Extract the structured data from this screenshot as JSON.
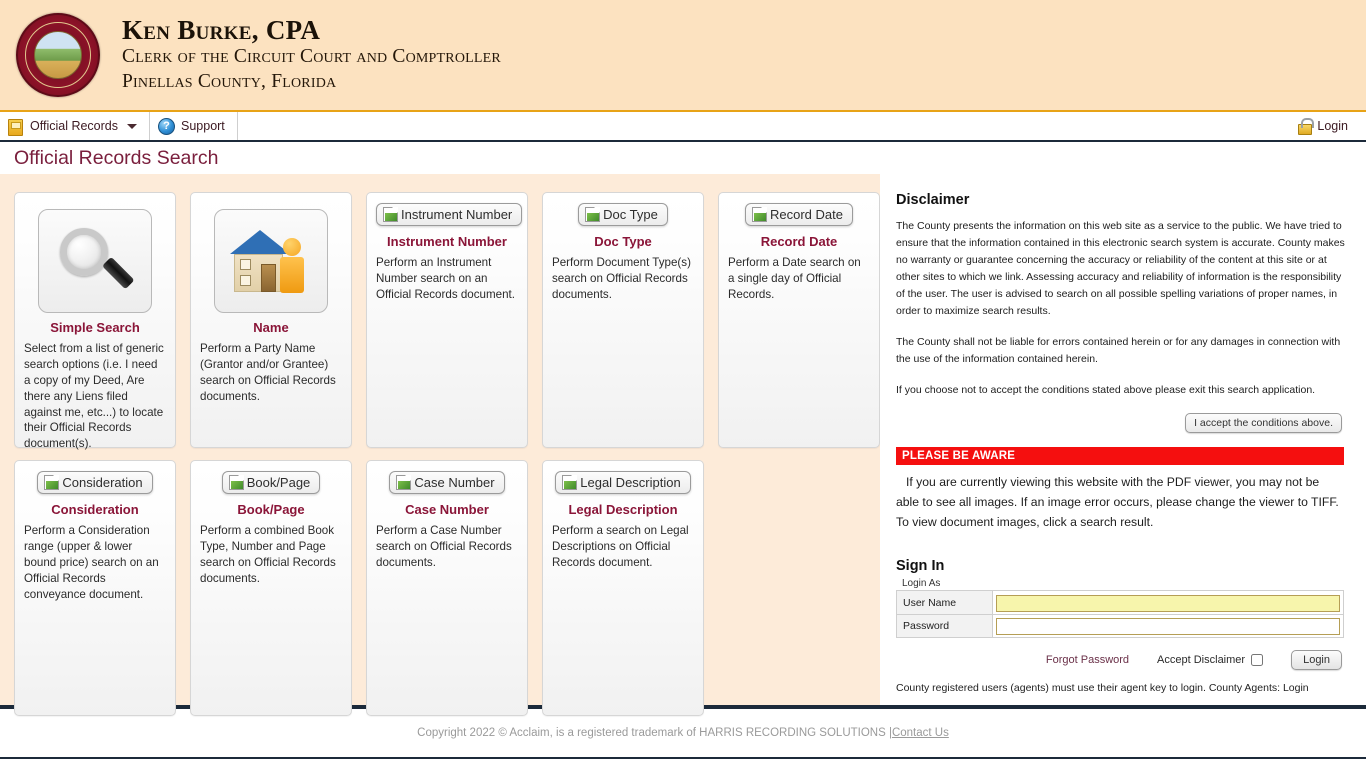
{
  "header": {
    "seal_icon": "county-seal",
    "title": "Ken Burke, CPA",
    "subtitle1": "Clerk of the Circuit Court and Comptroller",
    "subtitle2": "Pinellas County, Florida"
  },
  "nav": {
    "official_records": "Official Records",
    "official_records_icon": "folder-icon",
    "support": "Support",
    "support_icon": "help-icon",
    "login": "Login",
    "login_icon": "padlock-icon"
  },
  "page_title": "Official Records Search",
  "cards_row1": [
    {
      "icon": "magnifier-icon",
      "title": "Simple Search",
      "desc": "Select from a list of generic search options (i.e. I need a copy of my Deed, Are there any Liens filed against me, etc...) to locate their Official Records document(s)."
    },
    {
      "icon": "house-person-icon",
      "title": "Name",
      "desc": "Perform a Party Name (Grantor and/or Grantee) search on Official Records documents."
    },
    {
      "icon": "broken-image-icon",
      "alt": "Instrument Number",
      "title": "Instrument Number",
      "desc": "Perform an Instrument Number search on an Official Records document."
    },
    {
      "icon": "broken-image-icon",
      "alt": "Doc Type",
      "title": "Doc Type",
      "desc": "Perform Document Type(s) search on Official Records documents."
    },
    {
      "icon": "broken-image-icon",
      "alt": "Record Date",
      "title": "Record Date",
      "desc": "Perform a Date search on a single day of Official Records."
    }
  ],
  "cards_row2": [
    {
      "icon": "broken-image-icon",
      "alt": "Consideration",
      "title": "Consideration",
      "desc": "Perform a Consideration range (upper & lower bound price) search on an Official Records conveyance document."
    },
    {
      "icon": "broken-image-icon",
      "alt": "Book/Page",
      "title": "Book/Page",
      "desc": "Perform a combined Book Type, Number and Page search on Official Records documents."
    },
    {
      "icon": "broken-image-icon",
      "alt": "Case Number",
      "title": "Case Number",
      "desc": "Perform a Case Number search on Official Records documents."
    },
    {
      "icon": "broken-image-icon",
      "alt": "Legal Description",
      "title": "Legal Description",
      "desc": "Perform a search on Legal Descriptions on Official Records document."
    }
  ],
  "disclaimer": {
    "heading": "Disclaimer",
    "p1": "The County presents the information on this web site as a service to the public. We have tried to ensure that the information contained in this electronic search system is accurate. County makes no warranty or guarantee concerning the accuracy or reliability of the content at this site or at other sites to which we link. Assessing accuracy and reliability of information is the responsibility of the user. The user is advised to search on all possible spelling variations of proper names, in order to maximize search results.",
    "p2": "The County shall not be liable for errors contained herein or for any damages in connection with the use of the information contained herein.",
    "p3": "If you choose not to accept the conditions stated above please exit this search application.",
    "accept_button": "I accept the conditions above."
  },
  "aware": {
    "bar_label": "PLEASE BE AWARE",
    "text": "If you are currently viewing this website with the PDF viewer, you may not be able to see all images. If an image error occurs, please change the viewer to TIFF. To view document images, click a search result."
  },
  "signin": {
    "heading": "Sign In",
    "login_as": "Login As",
    "username_label": "User Name",
    "username_value": "",
    "password_label": "Password",
    "password_value": "",
    "forgot_password": "Forgot Password",
    "accept_disclaimer": "Accept Disclaimer",
    "login_button": "Login",
    "agent_note": "County registered users (agents) must use their agent key to login. County Agents: Login"
  },
  "footer": {
    "text": "Copyright 2022 © Acclaim, is a registered trademark of HARRIS RECORDING SOLUTIONS | ",
    "contact": "Contact Us"
  },
  "colors": {
    "header_bg": "#fce2c0",
    "panel_bg": "#fdebd9",
    "accent_maroon": "#8a1538",
    "alert_red": "#f50f0f",
    "rule_navy": "#1c2a3a",
    "nav_gold": "#e8a317"
  }
}
